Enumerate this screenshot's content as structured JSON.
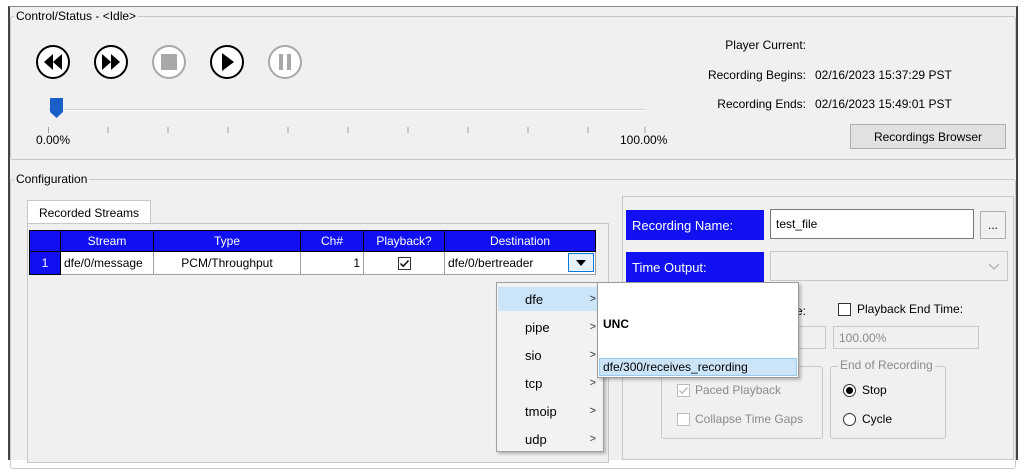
{
  "control": {
    "title": "Control/Status - <Idle>",
    "buttons": {
      "rewind_icon": "rewind-icon",
      "fast_forward_icon": "fast-forward-icon",
      "stop_icon": "stop-icon",
      "play_icon": "play-icon",
      "pause_icon": "pause-icon"
    },
    "slider": {
      "min_label": "0.00%",
      "max_label": "100.00%",
      "position_percent": 0
    },
    "info": {
      "player_current_label": "Player Current:",
      "player_current_value": "",
      "recording_begins_label": "Recording Begins:",
      "recording_begins_value": "02/16/2023 15:37:29 PST",
      "recording_ends_label": "Recording Ends:",
      "recording_ends_value": "02/16/2023 15:49:01 PST"
    },
    "recordings_browser_label": "Recordings Browser"
  },
  "configuration": {
    "title": "Configuration",
    "tab_label": "Recorded Streams",
    "table": {
      "headers": [
        "",
        "Stream",
        "Type",
        "Ch#",
        "Playback?",
        "Destination"
      ],
      "rows": [
        {
          "index": "1",
          "stream": "dfe/0/message",
          "type": "PCM/Throughput",
          "ch": "1",
          "playback": true,
          "destination": "dfe/0/bertreader"
        }
      ]
    },
    "dropdown_menu": {
      "items": [
        {
          "label": "dfe",
          "selected": true
        },
        {
          "label": "pipe",
          "selected": false
        },
        {
          "label": "sio",
          "selected": false
        },
        {
          "label": "tcp",
          "selected": false
        },
        {
          "label": "tmoip",
          "selected": false
        },
        {
          "label": "udp",
          "selected": false
        }
      ],
      "submenu": {
        "header": "UNC",
        "item": "dfe/300/receives_recording"
      }
    },
    "right_panel": {
      "recording_name_label": "Recording Name:",
      "recording_name_value": "test_file",
      "browse_label": "...",
      "time_output_label": "Time Output:",
      "time_output_value": "",
      "start_time_label_partial": "e:",
      "playback_end_time_label": "Playback End Time:",
      "start_time_value": "",
      "end_time_value": "100.00%",
      "paced_playback_label": "Paced Playback",
      "collapse_time_gaps_label": "Collapse Time Gaps",
      "end_of_recording_title": "End of Recording",
      "stop_label": "Stop",
      "cycle_label": "Cycle"
    }
  },
  "colors": {
    "header_blue": "#1010f0",
    "selection": "#cce4f7",
    "slider_thumb": "#1a5fc8"
  }
}
